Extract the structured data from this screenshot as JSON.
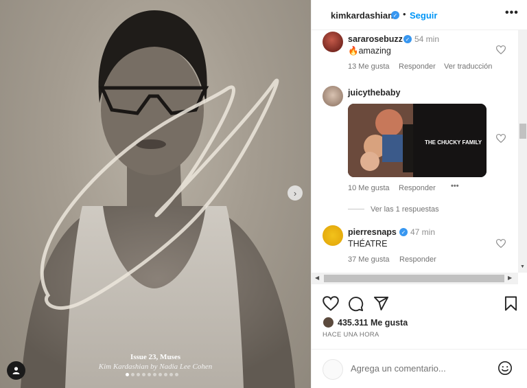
{
  "post": {
    "caption_title": "Issue 23, Muses",
    "caption_subtitle": "Kim Kardashian by Nadia Lee Cohen",
    "carousel_total": 10,
    "carousel_active": 1
  },
  "header": {
    "username": "kimkardashian",
    "separator": "•",
    "follow_label": "Seguir",
    "more_label": "•••"
  },
  "comments": [
    {
      "username": "sararosebuzz",
      "verified": true,
      "time": "54 min",
      "text": "🔥amazing",
      "likes": "13 Me gusta",
      "reply": "Responder",
      "translate": "Ver traducción"
    },
    {
      "username": "juicythebaby",
      "verified": false,
      "gif_text": "THE CHUCKY FAMILY",
      "likes": "10 Me gusta",
      "reply": "Responder",
      "more": "•••",
      "view_replies": "Ver las 1 respuestas"
    },
    {
      "username": "pierresnaps",
      "verified": true,
      "time": "47 min",
      "text": "THÉATRE",
      "likes": "37 Me gusta",
      "reply": "Responder"
    }
  ],
  "footer": {
    "likes_count": "435.311 Me gusta",
    "time_ago": "HACE UNA HORA",
    "comment_placeholder": "Agrega un comentario..."
  },
  "colors": {
    "accent": "#0095f6",
    "verified": "#3897f0",
    "text": "#262626",
    "muted": "#737373"
  },
  "icons": [
    "verified-badge-icon",
    "more-icon",
    "heart-icon",
    "comment-icon",
    "share-icon",
    "bookmark-icon",
    "emoji-icon",
    "chevron-right-icon",
    "user-tag-icon"
  ]
}
